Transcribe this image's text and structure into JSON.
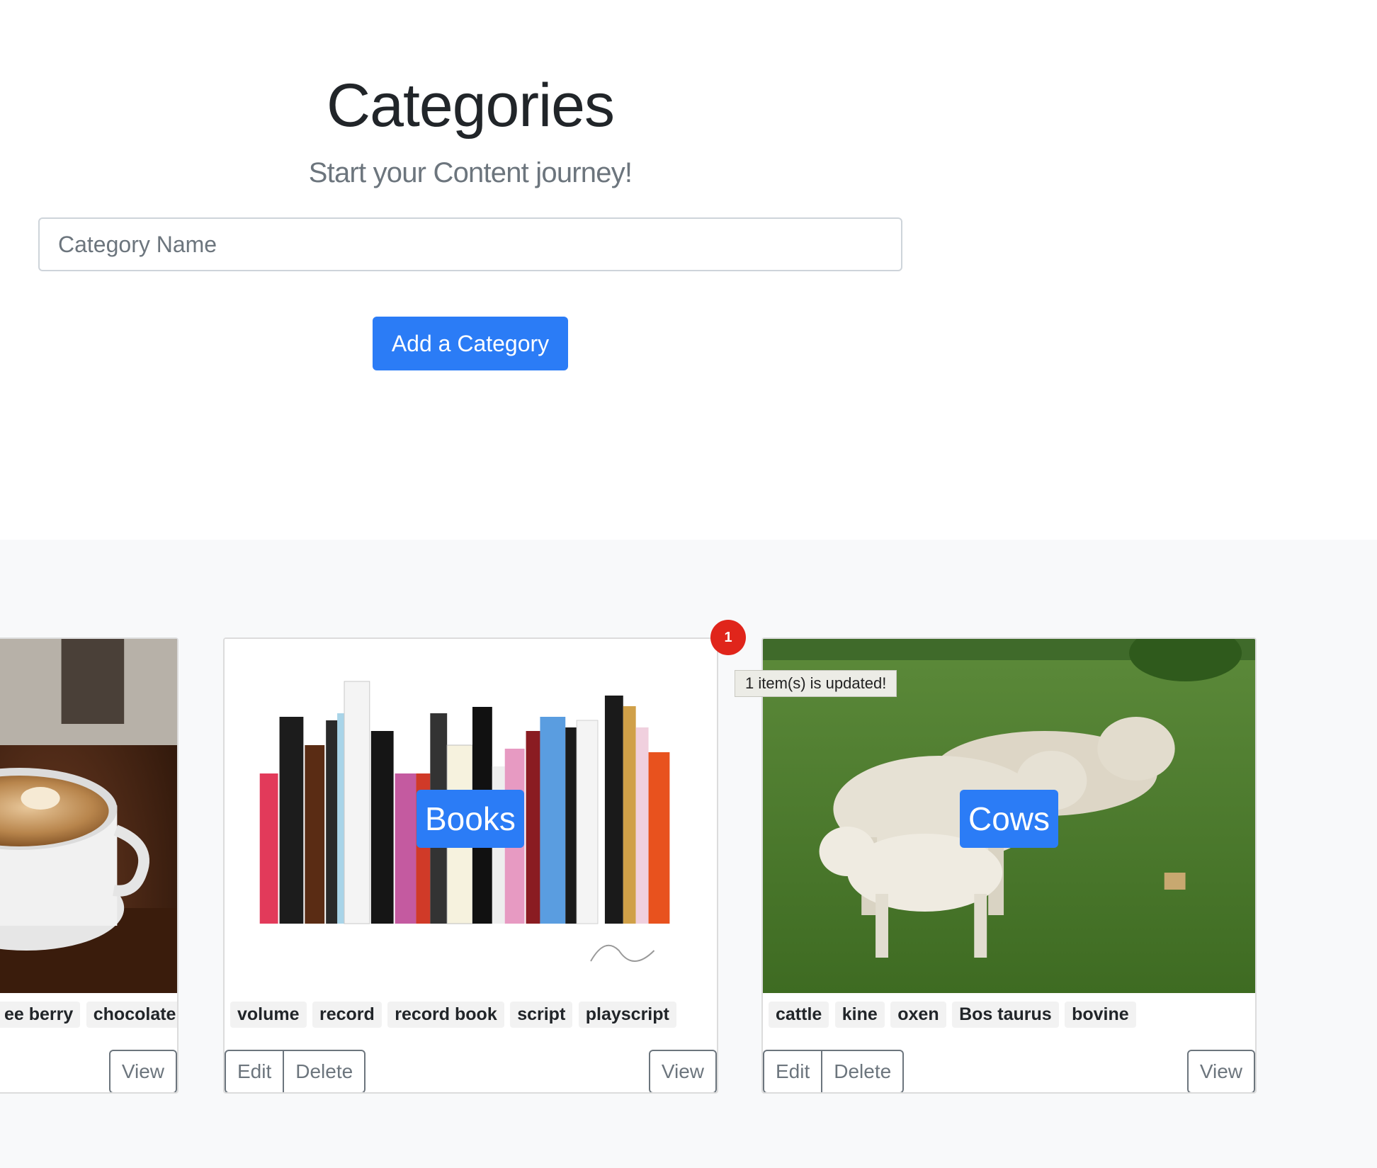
{
  "hero": {
    "title": "Categories",
    "subtitle": "Start your Content journey!",
    "input_placeholder": "Category Name",
    "add_button": "Add a Category"
  },
  "cards": [
    {
      "label": "",
      "tags": [
        "ee berry",
        "chocolate"
      ],
      "view": "View"
    },
    {
      "label": "Books",
      "tags": [
        "volume",
        "record",
        "record book",
        "script",
        "playscript"
      ],
      "edit": "Edit",
      "delete": "Delete",
      "view": "View"
    },
    {
      "label": "Cows",
      "tags": [
        "cattle",
        "kine",
        "oxen",
        "Bos taurus",
        "bovine"
      ],
      "edit": "Edit",
      "delete": "Delete",
      "view": "View"
    }
  ],
  "notification": {
    "badge_count": "1",
    "message": "1 item(s) is updated!"
  },
  "colors": {
    "primary": "#2b7cf6",
    "badge": "#e0251b",
    "album_bg": "#f8f9fa"
  }
}
